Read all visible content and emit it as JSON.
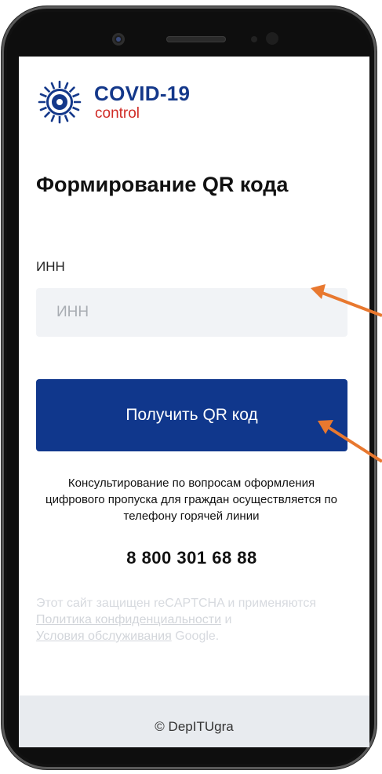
{
  "brand": {
    "title": "COVID-19",
    "subtitle": "control",
    "icon": "virus-logo-icon"
  },
  "page": {
    "title": "Формирование QR кода"
  },
  "form": {
    "inn_label": "ИНН",
    "inn_placeholder": "ИНН",
    "inn_value": "",
    "submit_label": "Получить QR код"
  },
  "support": {
    "text": "Консультирование по вопросам оформления цифрового пропуска для граждан осуществляется по телефону горячей линии",
    "phone": "8 800 301 68 88"
  },
  "recaptcha": {
    "prefix": "Этот сайт защищен reCAPTCHA и применяются",
    "privacy_link": "Политика конфиденциальности",
    "and": "и",
    "terms_link": "Условия обслуживания",
    "suffix": "Google."
  },
  "footer": {
    "copyright": "© DepITUgra"
  },
  "colors": {
    "brand_blue": "#14388a",
    "brand_red": "#d02c27",
    "button_bg": "#10378c",
    "annotation_arrow": "#e8782f"
  }
}
